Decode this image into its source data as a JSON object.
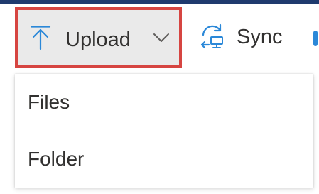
{
  "command_bar": {
    "upload": {
      "label": "Upload",
      "icon": "upload-arrow-icon",
      "expanded": true,
      "highlight_color": "#d64541"
    },
    "sync": {
      "label": "Sync",
      "icon": "sync-icon"
    }
  },
  "upload_menu": {
    "items": [
      {
        "label": "Files"
      },
      {
        "label": "Folder"
      }
    ]
  },
  "colors": {
    "accent": "#2b88d8",
    "text": "#323130",
    "button_background": "#eaeaea"
  }
}
